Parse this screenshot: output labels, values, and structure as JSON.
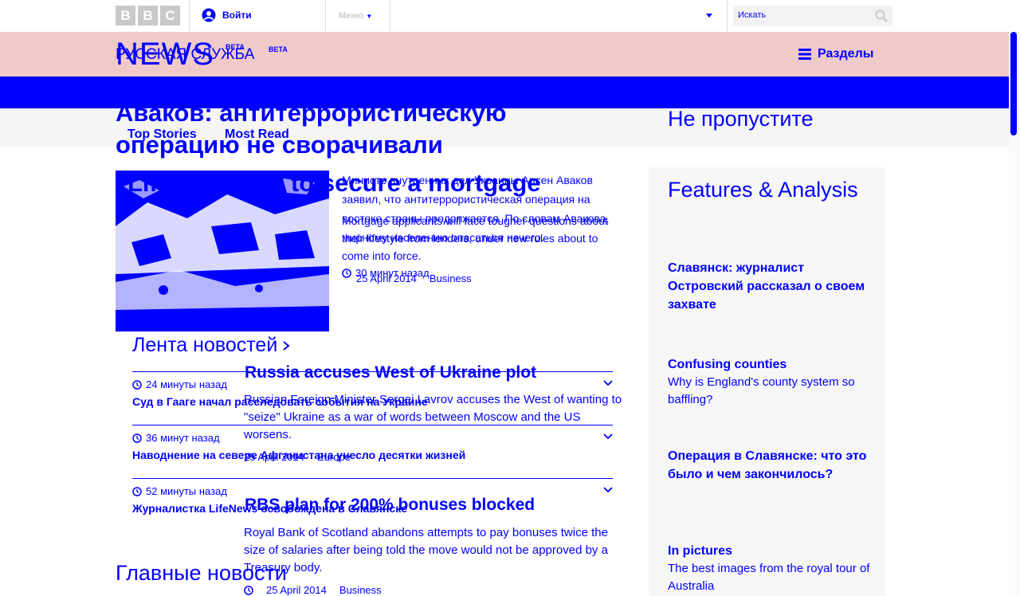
{
  "header": {
    "bbc_letters": [
      "B",
      "B",
      "C"
    ],
    "signin_label": "Войти",
    "menu_label": "Меню",
    "search_placeholder": "Искать",
    "search_icon": "search-icon"
  },
  "brand": {
    "news_logo": "NEWS",
    "beta_label": "BETA",
    "service_name": "РУССКАЯ СЛУЖБА",
    "beta_label_2": "BETA",
    "sections_label": "Разделы"
  },
  "tabs": [
    "Top Stories",
    "Most Read"
  ],
  "main": {
    "headline": "Аваков: антитеррористическую операцию не сворачивали",
    "quiz_headline": "Lifestyle quiz to secure a mortgage",
    "lead_text": "Министр внутренних дел Украины Арсен Аваков заявил, что антитеррористическая операция на востоке страны продолжается. По словам Авакова, мирному населению опасаться нечего.",
    "mortgage_text": "Mortgage applicants will face tougher questions about their lifestyle from lenders, under new rules about to come into force.",
    "lead_time": "30 минут назад",
    "mortgage_date": "25 April 2014",
    "mortgage_section": "Business"
  },
  "feed": {
    "title": "Лента новостей",
    "items": [
      {
        "time": "24 минуты назад",
        "headline": "Суд в Гааге начал расследовать события на Украине"
      },
      {
        "time": "36 минут назад",
        "headline": "Наводнение на севере Афганистана унесло десятки жизней"
      },
      {
        "time": "52 минуты назад",
        "headline": "Журналистка LifeNews освобождена в Славянске"
      }
    ]
  },
  "stories": [
    {
      "title": "Russia accuses West of Ukraine plot",
      "text": "Russian Foreign Minister Sergei Lavrov accuses the West of wanting to \"seize\" Ukraine as a war of words between Moscow and the US worsens.",
      "date": "25 April 2014",
      "section": "Europe"
    },
    {
      "title": "RBS plan for 200% bonuses blocked",
      "text": "Royal Bank of Scotland abandons attempts to pay bonuses twice the size of salaries after being told the move would not be approved by a Treasury body.",
      "date": "25 April 2014",
      "section": "Business"
    }
  ],
  "top_news_title": "Главные новости",
  "sidebar": {
    "dont_miss": "Не пропустите",
    "features_title": "Features & Analysis",
    "items": [
      {
        "headline": "Славянск: журналист Островский рассказал о своем захвате",
        "text": ""
      },
      {
        "headline": "Confusing counties",
        "text": "Why is England's county system so baffling?"
      },
      {
        "headline": "Операция в Славянске: что это было и чем закончилось?",
        "text": ""
      },
      {
        "headline": "In pictures",
        "text": "The best images from the royal tour of Australia"
      }
    ]
  },
  "colors": {
    "accent": "#0000ff",
    "brand_bar": "#f0c9c9",
    "logo_grey": "#c9c9c9"
  }
}
